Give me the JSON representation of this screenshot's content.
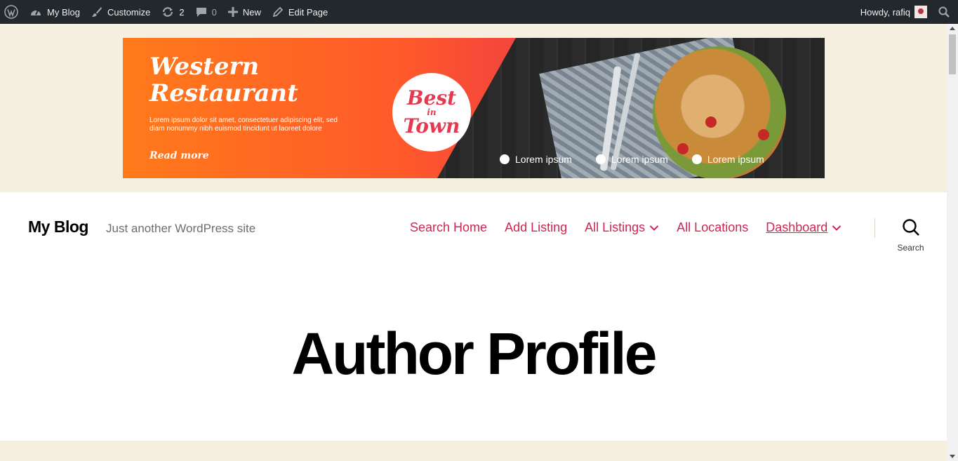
{
  "adminbar": {
    "wp_logo_icon": "wordpress-logo-icon",
    "site_label": "My Blog",
    "customize_label": "Customize",
    "updates_count": "2",
    "comments_count": "0",
    "new_label": "New",
    "edit_page_label": "Edit Page",
    "howdy_label": "Howdy, rafiq"
  },
  "banner": {
    "title_line1": "Western",
    "title_line2": "Restaurant",
    "description": "Lorem ipsum dolor sit amet, consectetuer adipiscing elit, sed diam nonummy nibh euismod tincidunt ut laoreet dolore",
    "read_more": "Read more",
    "badge_line1": "Best",
    "badge_line2": "in",
    "badge_line3": "Town",
    "bullets": [
      "Lorem ipsum",
      "Lorem ipsum",
      "Lorem ipsum"
    ]
  },
  "header": {
    "site_title": "My Blog",
    "tagline": "Just another WordPress site",
    "nav": [
      "Search Home",
      "Add Listing",
      "All Listings",
      "All Locations",
      "Dashboard"
    ],
    "search_label": "Search"
  },
  "main": {
    "page_title": "Author Profile"
  },
  "colors": {
    "adminbar_bg": "#23282d",
    "accent": "#cd2653",
    "page_bg": "#f5efe0"
  }
}
